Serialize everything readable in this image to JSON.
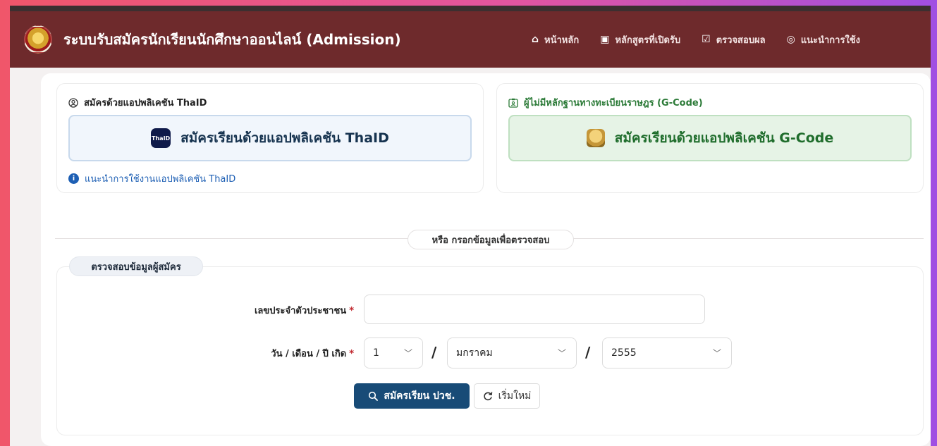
{
  "header": {
    "title": "ระบบรับสมัครนักเรียนนักศึกษาออนไลน์ (Admission)",
    "nav": [
      {
        "label": "หน้าหลัก",
        "icon": "home-icon",
        "glyph": "⌂"
      },
      {
        "label": "หลักสูตรที่เปิดรับ",
        "icon": "id-card-icon",
        "glyph": "▣"
      },
      {
        "label": "ตรวจสอบผล",
        "icon": "clipboard-check-icon",
        "glyph": "☑"
      },
      {
        "label": "แนะนำการใช้ง",
        "icon": "headset-icon",
        "glyph": "◎"
      }
    ]
  },
  "thaid": {
    "heading": "สมัครด้วยแอปพลิเคชัน ThaID",
    "button_label": "สมัครเรียนด้วยแอปพลิเคชัน ThaID",
    "badge": "ThaID",
    "help_link": "แนะนำการใช้งานแอปพลิเคชัน ThaID"
  },
  "gcode": {
    "heading": "ผู้ไม่มีหลักฐานทางทะเบียนราษฎร (G-Code)",
    "button_label": "สมัครเรียนด้วยแอปพลิเคชัน G-Code"
  },
  "divider": {
    "label": "หรือ กรอกข้อมูลเพื่อตรวจสอบ"
  },
  "form": {
    "legend": "ตรวจสอบข้อมูลผู้สมัคร",
    "id_label": "เลขประจำตัวประชาชน",
    "id_value": "",
    "dob_label": "วัน / เดือน / ปี เกิด",
    "required_mark": "*",
    "day": "1",
    "month": "มกราคม",
    "year": "2555",
    "slash": "/",
    "submit_label": "สมัครเรียน ปวช.",
    "reset_label": "เริ่มใหม่"
  },
  "colors": {
    "navbar": "#6e2a2c",
    "primary_button": "#184b77",
    "gcode_green": "#1f6d2c",
    "link_blue": "#1d5fb4",
    "required_red": "#c0262d"
  }
}
